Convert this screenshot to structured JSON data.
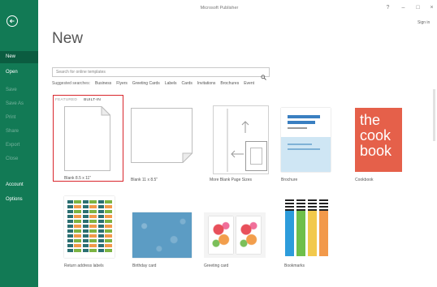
{
  "window": {
    "title": "Microsoft Publisher",
    "help": "?",
    "minimize": "–",
    "maximize": "□",
    "close": "×",
    "sign_in": "Sign in"
  },
  "sidebar": {
    "back_icon": "back-arrow-icon",
    "items": [
      {
        "label": "New",
        "selected": true
      },
      {
        "label": "Open"
      },
      {
        "label": "Save",
        "disabled": true
      },
      {
        "label": "Save As",
        "disabled": true
      },
      {
        "label": "Print",
        "disabled": true
      },
      {
        "label": "Share",
        "disabled": true
      },
      {
        "label": "Export",
        "disabled": true
      },
      {
        "label": "Close",
        "disabled": true
      },
      {
        "label": "Account"
      },
      {
        "label": "Options"
      }
    ]
  },
  "main": {
    "page_title": "New",
    "search": {
      "placeholder": "Search for online templates",
      "icon": "search-icon"
    },
    "suggested": {
      "label": "Suggested searches:",
      "items": [
        "Business",
        "Flyers",
        "Greeting Cards",
        "Labels",
        "Cards",
        "Invitations",
        "Brochures",
        "Event"
      ]
    },
    "tabs": [
      {
        "label": "FEATURED"
      },
      {
        "label": "BUILT-IN",
        "active": true
      }
    ]
  },
  "templates": [
    {
      "label": "Blank 8.5 x 11\""
    },
    {
      "label": "Blank 11 x 8.5\""
    },
    {
      "label": "More Blank Page Sizes"
    },
    {
      "label": "Brochure"
    },
    {
      "label": "Cookbook",
      "cover_text": [
        "the",
        "cook",
        "book"
      ]
    },
    {
      "label": "Return address labels"
    },
    {
      "label": "Birthday card"
    },
    {
      "label": "Greeting card"
    },
    {
      "label": "Bookmarks"
    }
  ],
  "colors": {
    "accent": "#127a55",
    "accent_selected": "#0b5c40",
    "highlight": "#d9262c",
    "cookbook": "#e5604a",
    "bookmarks": [
      "#2d9cdb",
      "#6fbf4a",
      "#f2c94c",
      "#f2994a"
    ]
  }
}
